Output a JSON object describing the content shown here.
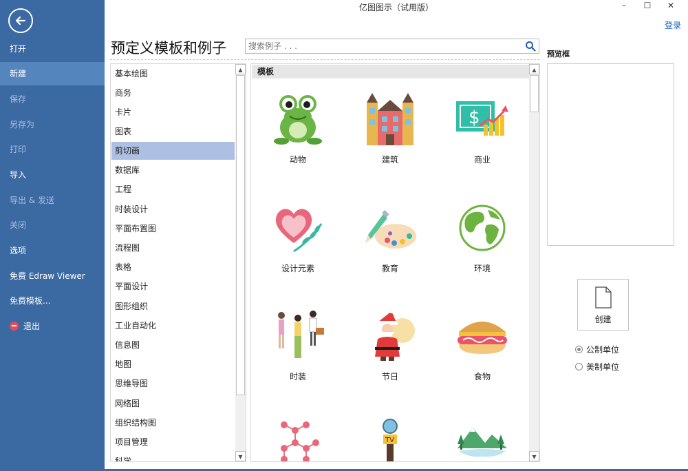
{
  "window": {
    "title": "亿图图示（试用版）",
    "minimize": "–",
    "maximize": "☐",
    "close": "✕",
    "login": "登录"
  },
  "sidebar": {
    "items": [
      {
        "label": "打开",
        "state": "normal"
      },
      {
        "label": "新建",
        "state": "active"
      },
      {
        "label": "保存",
        "state": "disabled"
      },
      {
        "label": "另存为",
        "state": "disabled"
      },
      {
        "label": "打印",
        "state": "disabled"
      },
      {
        "label": "导入",
        "state": "normal"
      },
      {
        "label": "导出 & 发送",
        "state": "disabled"
      },
      {
        "label": "关闭",
        "state": "disabled"
      },
      {
        "label": "选项",
        "state": "normal"
      },
      {
        "label": "免费 Edraw Viewer",
        "state": "normal"
      },
      {
        "label": "免费模板...",
        "state": "normal"
      },
      {
        "label": "退出",
        "state": "normal"
      }
    ]
  },
  "main": {
    "heading": "预定义模板和例子",
    "search_placeholder": "搜索例子 . . .",
    "gallery_header": "模板",
    "selected_category": "剪切画"
  },
  "categories": [
    "基本绘图",
    "商务",
    "卡片",
    "图表",
    "剪切画",
    "数据库",
    "工程",
    "时装设计",
    "平面布置图",
    "流程图",
    "表格",
    "平面设计",
    "图形组织",
    "工业自动化",
    "信息图",
    "地图",
    "思维导图",
    "网络图",
    "组织结构图",
    "项目管理",
    "科学"
  ],
  "templates": [
    {
      "label": "动物",
      "icon": "frog-icon"
    },
    {
      "label": "建筑",
      "icon": "building-icon"
    },
    {
      "label": "商业",
      "icon": "business-chart-icon"
    },
    {
      "label": "设计元素",
      "icon": "heart-icon"
    },
    {
      "label": "教育",
      "icon": "palette-icon"
    },
    {
      "label": "环境",
      "icon": "globe-icon"
    },
    {
      "label": "时装",
      "icon": "fashion-people-icon"
    },
    {
      "label": "节日",
      "icon": "santa-icon"
    },
    {
      "label": "食物",
      "icon": "burger-icon"
    },
    {
      "label": "",
      "icon": "molecule-icon"
    },
    {
      "label": "",
      "icon": "tv-microphone-icon"
    },
    {
      "label": "",
      "icon": "mountain-icon"
    }
  ],
  "preview": {
    "title": "预览框",
    "create_label": "创建",
    "units": [
      {
        "label": "公制单位",
        "checked": true
      },
      {
        "label": "美制单位",
        "checked": false
      }
    ]
  },
  "colors": {
    "sidebar": "#3b6aa3",
    "sidebar_active": "#5585bd",
    "selected_category": "#adbfe2",
    "link": "#1a66c9"
  }
}
